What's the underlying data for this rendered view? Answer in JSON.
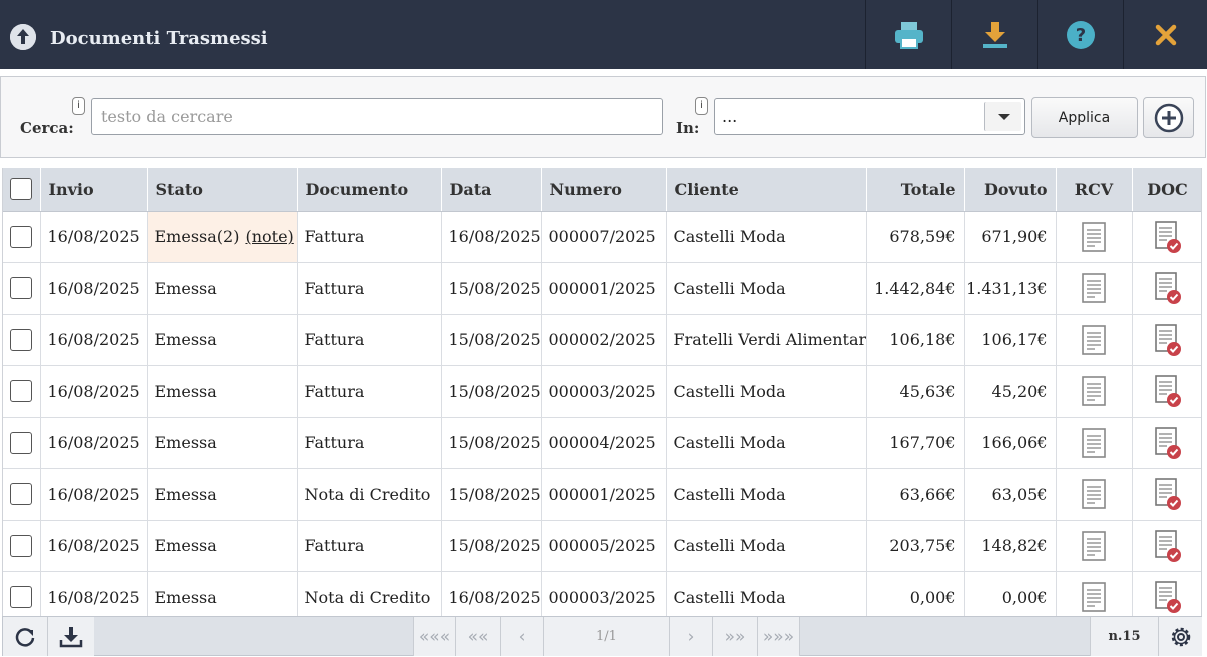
{
  "window": {
    "title": "Documenti Trasmessi",
    "toolbar": [
      "print-icon",
      "download-icon",
      "help-icon",
      "close-icon"
    ],
    "accent_color": "#2c3446",
    "icon_colors": {
      "print": "#55b4c9",
      "download": "#e3a23a",
      "help": "#4bb0c7",
      "close": "#e3a23a"
    }
  },
  "search": {
    "cerca_label": "Cerca:",
    "info_label": "i",
    "placeholder": "testo da cercare",
    "value": "",
    "in_label": "In:",
    "in_value": "...",
    "apply_label": "Applica"
  },
  "table": {
    "columns": [
      "Invio",
      "Stato",
      "Documento",
      "Data",
      "Numero",
      "Cliente",
      "Totale",
      "Dovuto",
      "RCV",
      "DOC"
    ],
    "rows": [
      {
        "invio": "16/08/2025",
        "stato": "Emessa(2)",
        "note": "(note)",
        "documento": "Fattura",
        "data": "16/08/2025",
        "numero": "000007/2025",
        "cliente": "Castelli Moda",
        "totale": "678,59€",
        "dovuto": "671,90€"
      },
      {
        "invio": "16/08/2025",
        "stato": "Emessa",
        "documento": "Fattura",
        "data": "15/08/2025",
        "numero": "000001/2025",
        "cliente": "Castelli Moda",
        "totale": "1.442,84€",
        "dovuto": "1.431,13€"
      },
      {
        "invio": "16/08/2025",
        "stato": "Emessa",
        "documento": "Fattura",
        "data": "15/08/2025",
        "numero": "000002/2025",
        "cliente": "Fratelli Verdi Alimentari",
        "totale": "106,18€",
        "dovuto": "106,17€"
      },
      {
        "invio": "16/08/2025",
        "stato": "Emessa",
        "documento": "Fattura",
        "data": "15/08/2025",
        "numero": "000003/2025",
        "cliente": "Castelli Moda",
        "totale": "45,63€",
        "dovuto": "45,20€"
      },
      {
        "invio": "16/08/2025",
        "stato": "Emessa",
        "documento": "Fattura",
        "data": "15/08/2025",
        "numero": "000004/2025",
        "cliente": "Castelli Moda",
        "totale": "167,70€",
        "dovuto": "166,06€"
      },
      {
        "invio": "16/08/2025",
        "stato": "Emessa",
        "documento": "Nota di Credito",
        "data": "15/08/2025",
        "numero": "000001/2025",
        "cliente": "Castelli Moda",
        "totale": "63,66€",
        "dovuto": "63,05€"
      },
      {
        "invio": "16/08/2025",
        "stato": "Emessa",
        "documento": "Fattura",
        "data": "15/08/2025",
        "numero": "000005/2025",
        "cliente": "Castelli Moda",
        "totale": "203,75€",
        "dovuto": "148,82€"
      },
      {
        "invio": "16/08/2025",
        "stato": "Emessa",
        "documento": "Nota di Credito",
        "data": "16/08/2025",
        "numero": "000003/2025",
        "cliente": "Castelli Moda",
        "totale": "0,00€",
        "dovuto": "0,00€"
      }
    ]
  },
  "footer": {
    "page": "1/1",
    "count": "n.15",
    "nav": [
      "«««",
      "««",
      "‹",
      "›",
      "»»",
      "»»»"
    ]
  }
}
